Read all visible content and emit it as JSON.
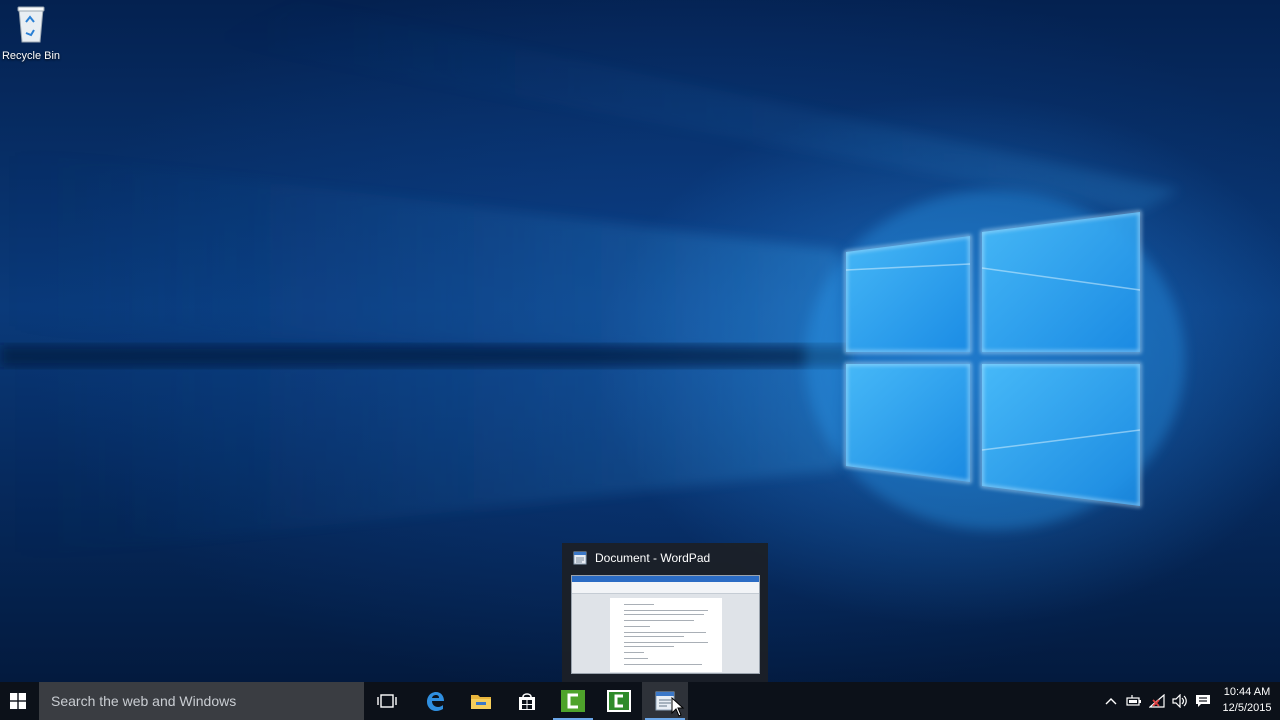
{
  "desktop": {
    "icons": [
      {
        "label": "Recycle Bin",
        "icon": "recycle-bin-icon"
      }
    ]
  },
  "thumbnail_preview": {
    "title": "Document - WordPad",
    "icon": "wordpad-icon"
  },
  "taskbar": {
    "start_icon": "windows-logo-icon",
    "search": {
      "placeholder": "Search the web and Windows"
    },
    "buttons": [
      {
        "name": "task-view",
        "icon": "task-view-icon",
        "running": false
      },
      {
        "name": "edge",
        "icon": "edge-icon",
        "running": false
      },
      {
        "name": "file-explorer",
        "icon": "folder-icon",
        "running": false
      },
      {
        "name": "store",
        "icon": "store-icon",
        "running": false
      },
      {
        "name": "camtasia-recorder",
        "icon": "camtasia-icon",
        "running": true
      },
      {
        "name": "camtasia-studio",
        "icon": "camtasia-icon",
        "running": false
      },
      {
        "name": "wordpad",
        "icon": "wordpad-icon",
        "running": true,
        "active": true
      }
    ],
    "tray": {
      "icons": [
        "chevron-up-icon",
        "battery-icon",
        "network-icon",
        "volume-icon",
        "action-center-icon"
      ],
      "time": "10:44 AM",
      "date": "12/5/2015"
    }
  },
  "colors": {
    "taskbar": "#0c1119",
    "search_box": "#3a3d42",
    "accent": "#6aa6e8",
    "wallpaper_glow": "#3fb4ff"
  }
}
